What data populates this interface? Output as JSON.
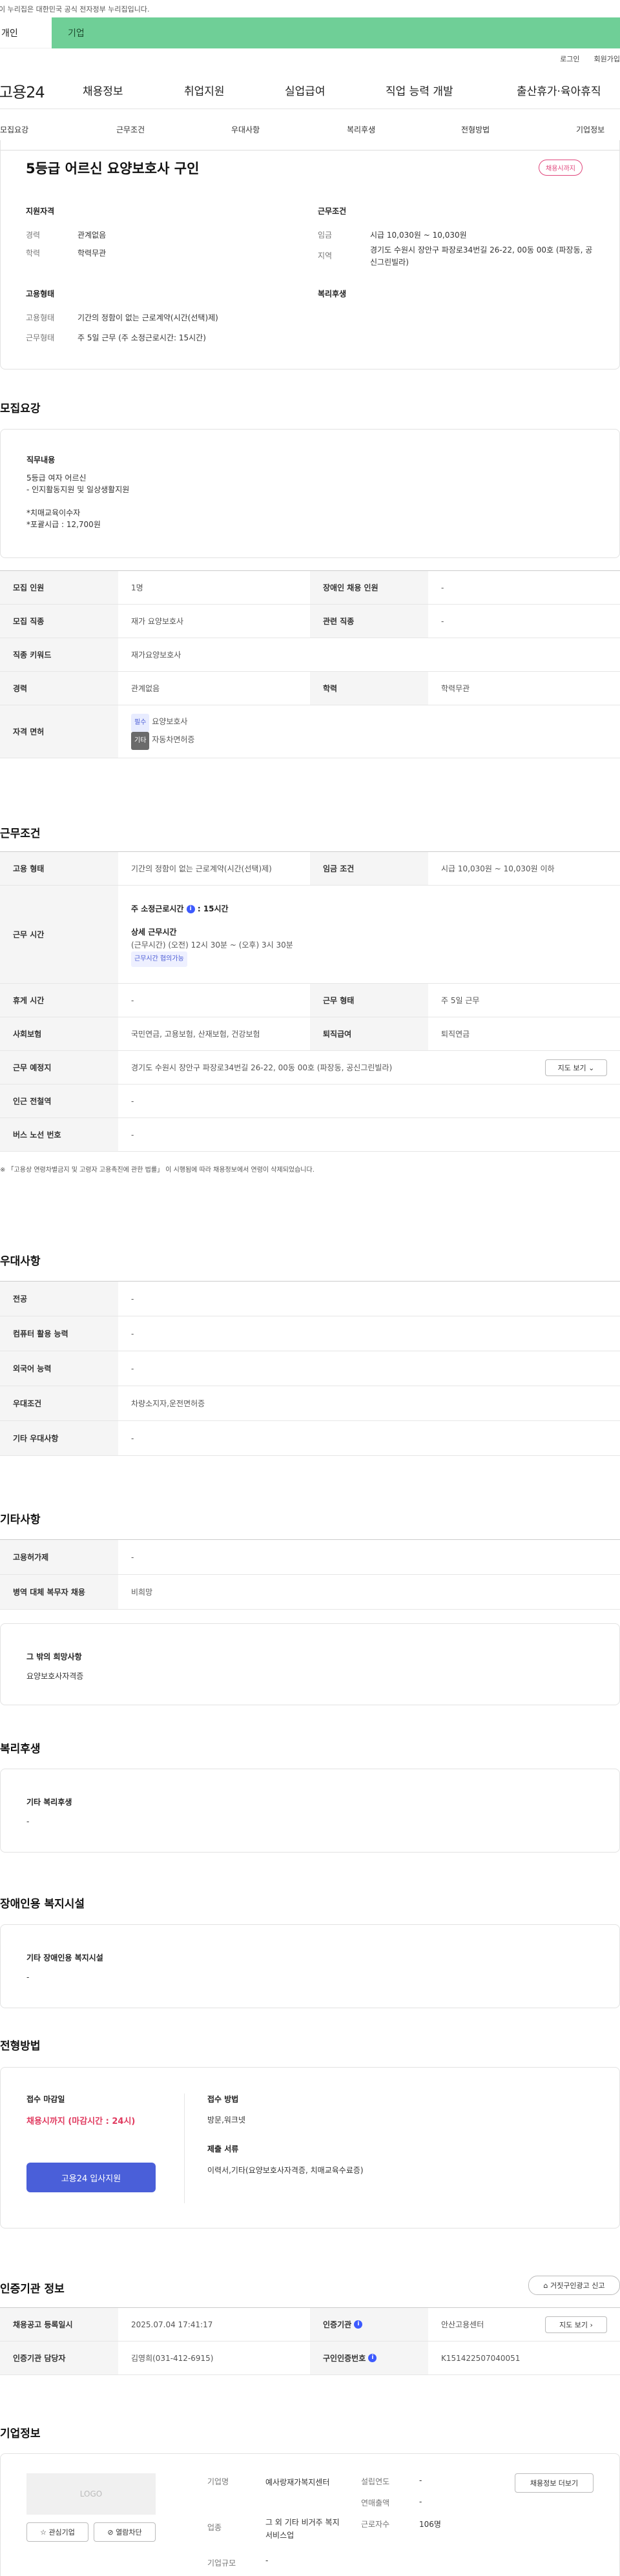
{
  "top": {
    "notice": "이 누리집은 대한민국 공식 전자정부 누리집입니다.",
    "tab_individual": "개인",
    "tab_corporate": "기업"
  },
  "utility": {
    "login": "로그인",
    "signup": "회원가입"
  },
  "gnb": {
    "logo": "고용24",
    "items": [
      "채용정보",
      "취업지원",
      "실업급여",
      "직업 능력 개발",
      "출산휴가·육아휴직"
    ]
  },
  "anchors": [
    "모집요강",
    "근무조건",
    "우대사항",
    "복리후생",
    "전형방법",
    "기업정보"
  ],
  "summary": {
    "title": "5등급 어르신 요양보호사 구인",
    "deadline_badge": "채용시까지",
    "qual_title": "지원자격",
    "career_label": "경력",
    "career_value": "관계없음",
    "edu_label": "학력",
    "edu_value": "학력무관",
    "emp_title": "고용형태",
    "emp_type_label": "고용형태",
    "emp_type_value": "기간의 정함이 없는 근로계약(시간(선택)제)",
    "work_type_label": "근무형태",
    "work_type_value": "주 5일 근무 (주 소정근로시간: 15시간)",
    "cond_title": "근무조건",
    "wage_label": "임금",
    "wage_value": "시급 10,030원 ~ 10,030원",
    "region_label": "지역",
    "region_value": "경기도 수원시 장안구 파장로34번길 26-22, 00동 00호 (파장동, 공신그린빌라)",
    "welfare_title": "복리후생"
  },
  "recruit": {
    "title": "모집요강",
    "job_title": "직무내용",
    "job_lines": [
      "5등급 여자 어르신",
      "- 인지활동지원 및 일상생활지원",
      "",
      "*치매교육이수자",
      "*포괄시급 : 12,700원"
    ],
    "rows": [
      {
        "l1": "모집 인원",
        "v1": "1명",
        "l2": "장애인 채용 인원",
        "v2": "-"
      },
      {
        "l1": "모집 직종",
        "v1": "재가 요양보호사",
        "l2": "관련 직종",
        "v2": "-"
      },
      {
        "l1": "직종 키워드",
        "v1": "재가요양보호사"
      },
      {
        "l1": "경력",
        "v1": "관계없음",
        "l2": "학력",
        "v2": "학력무관"
      }
    ],
    "license_label": "자격 면허",
    "license_req_badge": "필수",
    "license_req": "요양보호사",
    "license_etc_badge": "기타",
    "license_etc": "자동차면허증"
  },
  "conditions": {
    "title": "근무조건",
    "emp_label": "고용 형태",
    "emp_value": "기간의 정함이 없는 근로계약(시간(선택)제)",
    "wage_label": "임금 조건",
    "wage_value": "시급 10,030원 ~ 10,030원 이하",
    "hours_label": "근무 시간",
    "hours_weekly": "주 소정근로시간",
    "hours_weekly_value": ": 15시간",
    "hours_detail_title": "상세 근무시간",
    "hours_detail": "(근무시간) (오전) 12시 30분 ~ (오후) 3시 30분",
    "hours_badge": "근무시간 협의가능",
    "rest_label": "휴게 시간",
    "rest_value": "-",
    "form_label": "근무 형태",
    "form_value": "주 5일 근무",
    "insurance_label": "사회보험",
    "insurance_value": "국민연금, 고용보험, 산재보험, 건강보험",
    "retire_label": "퇴직급여",
    "retire_value": "퇴직연금",
    "place_label": "근무 예정지",
    "place_value": "경기도 수원시 장안구 파장로34번길 26-22, 00동 00호 (파장동, 공신그린빌라)",
    "map_button": "지도 보기",
    "subway_label": "인근 전철역",
    "subway_value": "-",
    "bus_label": "버스 노선 번호",
    "bus_value": "-",
    "footnote": "※ 「고용상 연령차별금지 및 고령자 고용촉진에 관한 법률」 이 시행됨에 따라 채용정보에서 연령이 삭제되었습니다."
  },
  "preference": {
    "title": "우대사항",
    "rows": [
      {
        "l": "전공",
        "v": "-"
      },
      {
        "l": "컴퓨터 활용 능력",
        "v": "-"
      },
      {
        "l": "외국어 능력",
        "v": "-"
      },
      {
        "l": "우대조건",
        "v": "차량소지자,운전면허증"
      },
      {
        "l": "기타 우대사항",
        "v": "-"
      }
    ]
  },
  "etc": {
    "title": "기타사항",
    "rows": [
      {
        "l": "고용허가제",
        "v": "-"
      },
      {
        "l": "병역 대체 복무자 채용",
        "v": "비희망"
      }
    ],
    "wish_title": "그 밖의 희망사항",
    "wish_value": "요양보호사자격증"
  },
  "welfare": {
    "title": "복리후생",
    "box_title": "기타 복리후생",
    "box_value": "-"
  },
  "disabled": {
    "title": "장애인용 복지시설",
    "box_title": "기타 장애인용 복지시설",
    "box_value": "-"
  },
  "screening": {
    "title": "전형방법",
    "deadline_title": "접수 마감일",
    "deadline_value": "채용시까지 (마감시간 : 24시)",
    "apply_button": "고용24 입사지원",
    "method_title": "접수 방법",
    "method_value": "방문,워크넷",
    "docs_title": "제출 서류",
    "docs_value": "이력서,기타(요양보호사자격증, 치매교육수료증)"
  },
  "cert": {
    "title": "인증기관 정보",
    "report_button": "거짓구인광고 신고",
    "reg_label": "채용공고 등록일시",
    "reg_value": "2025.07.04 17:41:17",
    "agency_label": "인증기관",
    "agency_value": "안산고용센터",
    "map_button": "지도 보기",
    "manager_label": "인증기관 담당자",
    "manager_value": "김영희(031-412-6915)",
    "id_label": "구인인증번호",
    "id_value": "K151422507040051"
  },
  "company": {
    "title": "기업정보",
    "logo_text": "LOGO",
    "fav_button": "관심기업",
    "block_button": "열람차단",
    "name_label": "기업명",
    "name_value": "예사랑재가복지센터",
    "industry_label": "업종",
    "industry_value": "그 외 기타 비거주 복지 서비스업",
    "size_label": "기업규모",
    "size_value": "-",
    "year_label": "설립연도",
    "year_value": "-",
    "sales_label": "연매출액",
    "sales_value": "-",
    "emp_label": "근로자수",
    "emp_value": "106명",
    "recruit_button": "채용정보 더보기"
  }
}
